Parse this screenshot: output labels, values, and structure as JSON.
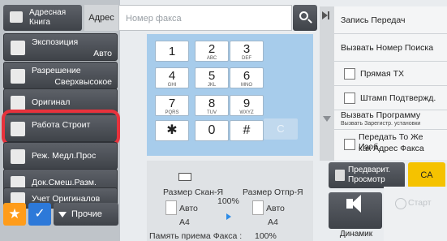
{
  "address_book": {
    "label": "Адресная Книга"
  },
  "address_label": "Адрес",
  "fax_input": {
    "placeholder": "Номер факса"
  },
  "left_menu": [
    {
      "line1": "Экспозиция",
      "line2": "Авто"
    },
    {
      "line1": "Разрешение",
      "line2": "Сверхвысокое"
    },
    {
      "line1": "Оригинал",
      "line2": ""
    },
    {
      "line1": "Работа Строит",
      "line2": ""
    },
    {
      "line1": "Реж. Медл.Прос",
      "line2": ""
    },
    {
      "line1": "Док.Смеш.Разм.",
      "line2": ""
    },
    {
      "line1": "Учет Оригиналов",
      "line2": ""
    }
  ],
  "other_button": "Прочие",
  "keypad": {
    "k1": {
      "n": "1",
      "s": ""
    },
    "k2": {
      "n": "2",
      "s": "ABC"
    },
    "k3": {
      "n": "3",
      "s": "DEF"
    },
    "k4": {
      "n": "4",
      "s": "GHI"
    },
    "k5": {
      "n": "5",
      "s": "JKL"
    },
    "k6": {
      "n": "6",
      "s": "MNO"
    },
    "k7": {
      "n": "7",
      "s": "PQRS"
    },
    "k8": {
      "n": "8",
      "s": "TUV"
    },
    "k9": {
      "n": "9",
      "s": "WXYZ"
    },
    "kstar": "✱",
    "k0": "0",
    "khash": "#",
    "kclear": "C"
  },
  "scan": {
    "scan_size_label": "Размер Скан-Я",
    "send_size_label": "Размер Отпр-Я",
    "ratio": "100%",
    "scan_mode": "Авто",
    "scan_paper": "A4",
    "send_mode": "Авто",
    "send_paper": "A4",
    "memory_label": "Память приема Факса :",
    "memory_value": "100%"
  },
  "right_menu": {
    "send_record": "Запись Передач",
    "search_number": "Вызвать Номер Поиска",
    "direct_tx": "Прямая TX",
    "stamp": "Штамп Подтвержд.",
    "call_program": "Вызвать Программу",
    "call_program_sub": "Вызвать Зарегистр. установки",
    "transfer_line1": "Передать То Же Изоб.",
    "transfer_line2": "как Адрес Факса"
  },
  "preview": {
    "line1": "Предварит.",
    "line2": "Просмотр"
  },
  "ca_button": "CA",
  "speaker_label": "Динамик",
  "start_button": "Старт",
  "colors": {
    "highlight_ring": "#e8323c",
    "keypad_bg": "#a7cceb",
    "ca_yellow": "#f5c200",
    "favorite_orange": "#ff9c1a",
    "check_blue": "#2d79d9"
  }
}
